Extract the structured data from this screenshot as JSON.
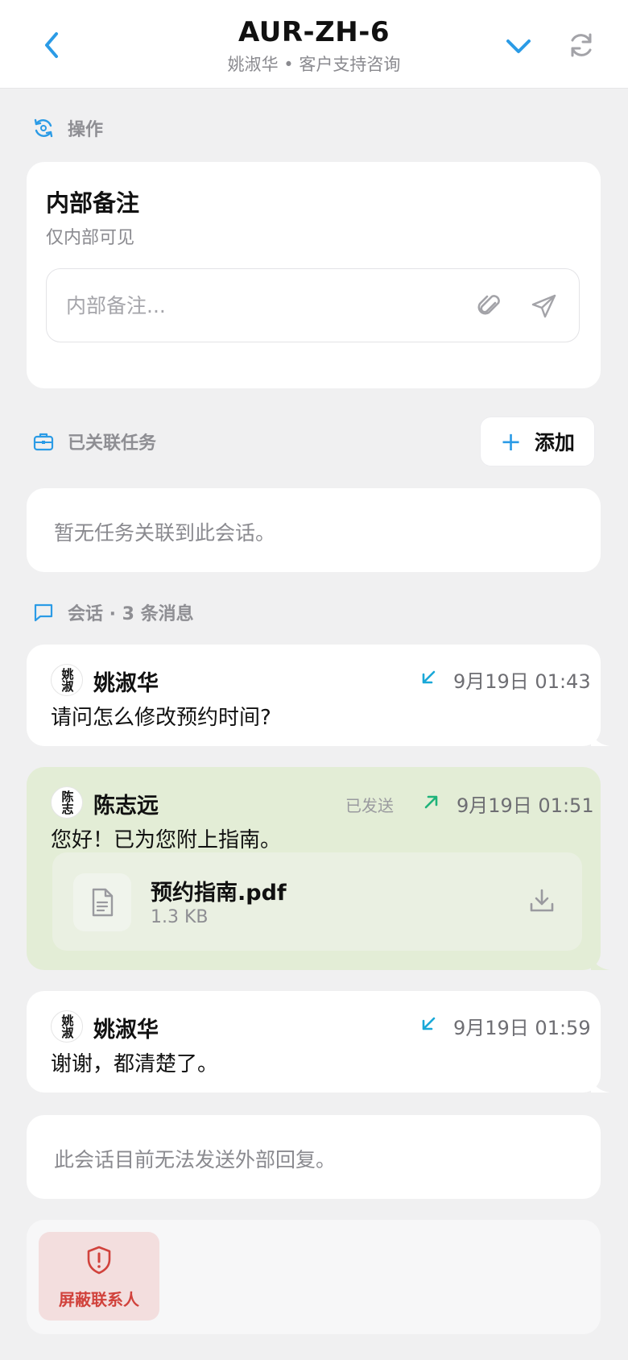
{
  "header": {
    "title": "AUR-ZH-6",
    "subtitle": "姚淑华 • 客户支持咨询"
  },
  "actions": {
    "section_label": "操作",
    "note_title": "内部备注",
    "note_subtitle": "仅内部可见",
    "note_placeholder": "内部备注..."
  },
  "tasks": {
    "section_label": "已关联任务",
    "add_label": "添加",
    "empty_text": "暂无任务关联到此会话。"
  },
  "conversation": {
    "section_label": "会话 · 3 条消息",
    "messages": [
      {
        "sender": "姚淑华",
        "avatar_text": "姚淑",
        "direction": "incoming",
        "time": "9月19日 01:43",
        "text": "请问怎么修改预约时间?"
      },
      {
        "sender": "陈志远",
        "avatar_text": "陈志",
        "direction": "outgoing",
        "status": "已发送",
        "time": "9月19日 01:51",
        "text": "您好！已为您附上指南。",
        "attachment": {
          "name": "预约指南.pdf",
          "size": "1.3 KB"
        }
      },
      {
        "sender": "姚淑华",
        "avatar_text": "姚淑",
        "direction": "incoming",
        "time": "9月19日 01:59",
        "text": "谢谢，都清楚了。"
      }
    ],
    "reply_disabled_text": "此会话目前无法发送外部回复。"
  },
  "block": {
    "label": "屏蔽联系人"
  },
  "colors": {
    "accent": "#2b9be6",
    "incoming_arrow": "#19a8d8",
    "outgoing_arrow": "#1fb37a",
    "outgoing_bubble": "#e3edd6",
    "danger": "#d1423c"
  }
}
